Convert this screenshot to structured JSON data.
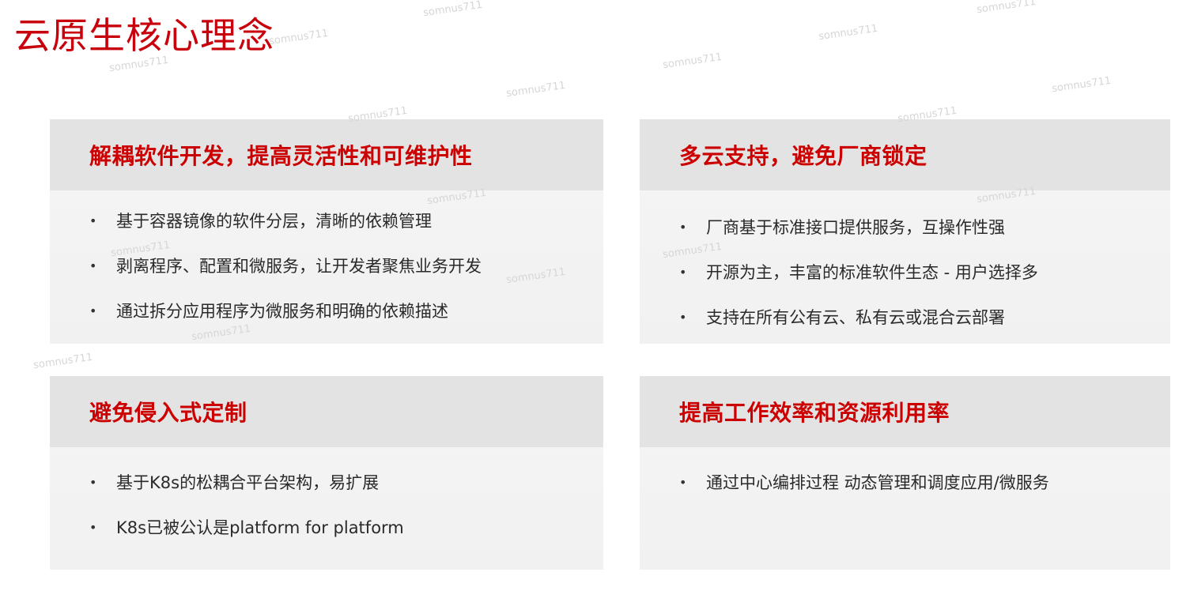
{
  "page": {
    "title": "云原生核心理念"
  },
  "cards": [
    {
      "title": "解耦软件开发，提高灵活性和可维护性",
      "items": [
        "基于容器镜像的软件分层，清晰的依赖管理",
        "剥离程序、配置和微服务，让开发者聚焦业务开发",
        "通过拆分应用程序为微服务和明确的依赖描述"
      ]
    },
    {
      "title": "多云支持，避免厂商锁定",
      "items": [
        "厂商基于标准接口提供服务，互操作性强",
        "开源为主，丰富的标准软件生态 - 用户选择多",
        "支持在所有公有云、私有云或混合云部署"
      ]
    },
    {
      "title": "避免侵入式定制",
      "items": [
        "基于K8s的松耦合平台架构，易扩展",
        "K8s已被公认是platform for platform"
      ]
    },
    {
      "title": "提高工作效率和资源利用率",
      "items": [
        "通过中心编排过程 动态管理和调度应用/微服务"
      ]
    }
  ],
  "bullet_glyph": "•",
  "watermark_text": "somnus711",
  "colors": {
    "accent_red": "#c8000b",
    "card_header_bg": "#e3e3e3",
    "card_body_bg": "#f3f3f3"
  }
}
